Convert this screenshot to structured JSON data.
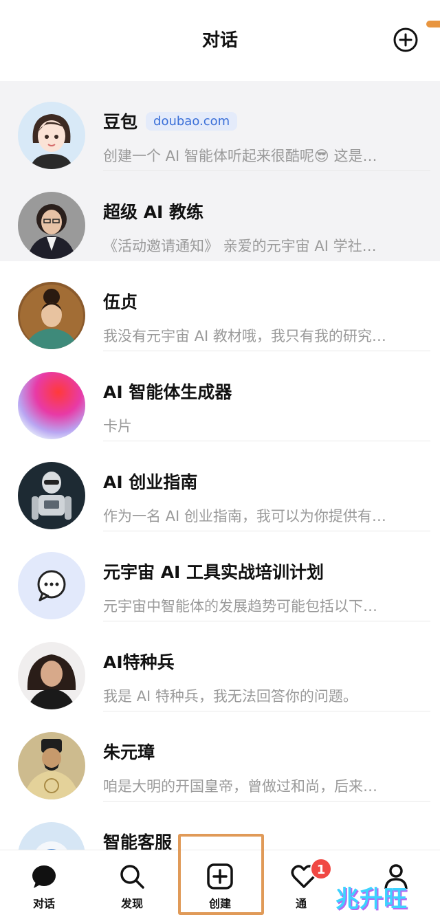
{
  "header": {
    "title": "对话",
    "add_icon": "plus-circle-icon"
  },
  "conversations": [
    {
      "name": "豆包",
      "badge": "doubao.com",
      "preview": "创建一个 AI 智能体听起来很酷呢😎 这是…"
    },
    {
      "name": "超级 AI 教练",
      "preview": "《活动邀请通知》 亲爱的元宇宙 AI 学社…"
    },
    {
      "name": "伍贞",
      "preview": "我没有元宇宙 AI 教材哦，我只有我的研究…"
    },
    {
      "name": "AI 智能体生成器",
      "preview": "卡片"
    },
    {
      "name": "AI 创业指南",
      "preview": "作为一名 AI 创业指南，我可以为你提供有…"
    },
    {
      "name": "元宇宙 AI 工具实战培训计划",
      "preview": "元宇宙中智能体的发展趋势可能包括以下…"
    },
    {
      "name": "AI特种兵",
      "preview": "我是 AI 特种兵，我无法回答你的问题。"
    },
    {
      "name": "朱元璋",
      "preview": "咱是大明的开国皇帝，曾做过和尚，后来…"
    },
    {
      "name": "智能客服",
      "preview": ""
    }
  ],
  "tabbar": {
    "tabs": [
      {
        "label": "对话",
        "icon": "chat-bubble-icon"
      },
      {
        "label": "发现",
        "icon": "search-icon"
      },
      {
        "label": "创建",
        "icon": "plus-square-icon"
      },
      {
        "label": "通",
        "icon": "heart-icon"
      },
      {
        "label": "",
        "icon": "person-icon"
      }
    ],
    "notification_count": "1"
  },
  "watermark": "兆升旺",
  "colors": {
    "pinned_bg": "#f3f3f5",
    "badge_text": "#3a6fd8",
    "notif": "#f04843",
    "highlight": "#e09a58"
  }
}
